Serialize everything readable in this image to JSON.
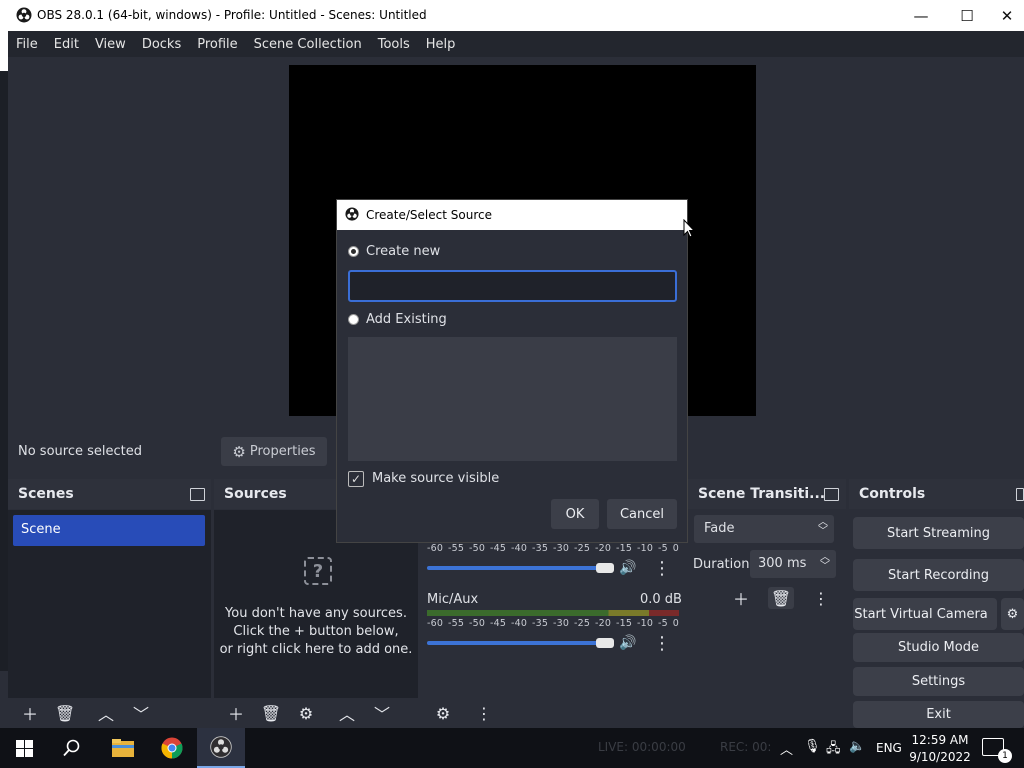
{
  "window": {
    "title": "OBS 28.0.1 (64-bit, windows) - Profile: Untitled - Scenes: Untitled",
    "minimize": "—",
    "maximize": "☐",
    "close": "✕"
  },
  "menu": [
    "File",
    "Edit",
    "View",
    "Docks",
    "Profile",
    "Scene Collection",
    "Tools",
    "Help"
  ],
  "source_bar": {
    "no_source": "No source selected",
    "properties": "Properties"
  },
  "scenes": {
    "title": "Scenes",
    "items": [
      "Scene"
    ]
  },
  "sources": {
    "title": "Sources",
    "empty_line1": "You don't have any sources.",
    "empty_line2": "Click the + button below,",
    "empty_line3": "or right click here to add one."
  },
  "mixer": {
    "scale": [
      "-60",
      "-55",
      "-50",
      "-45",
      "-40",
      "-35",
      "-30",
      "-25",
      "-20",
      "-15",
      "-10",
      "-5",
      "0"
    ],
    "channel2": {
      "name": "Mic/Aux",
      "level": "0.0 dB"
    }
  },
  "transitions": {
    "title": "Scene Transiti...",
    "selected": "Fade",
    "duration_label": "Duration",
    "duration_value": "300 ms"
  },
  "controls": {
    "title": "Controls",
    "start_streaming": "Start Streaming",
    "start_recording": "Start Recording",
    "start_virtual_camera": "Start Virtual Camera",
    "studio_mode": "Studio Mode",
    "settings": "Settings",
    "exit": "Exit"
  },
  "dialog": {
    "title": "Create/Select Source",
    "create_new": "Create new",
    "name_value": "",
    "add_existing": "Add Existing",
    "make_visible": "Make source visible",
    "make_visible_checked": true,
    "ok": "OK",
    "cancel": "Cancel"
  },
  "statusbar": {
    "live": "LIVE: 00:00:00",
    "rec": "REC: 00:"
  },
  "taskbar": {
    "lang": "ENG",
    "time": "12:59 AM",
    "date": "9/10/2022",
    "notification_count": "1"
  },
  "colors": {
    "accent": "#284cb8",
    "panel": "#2b2e38",
    "dark": "#1f222a"
  }
}
